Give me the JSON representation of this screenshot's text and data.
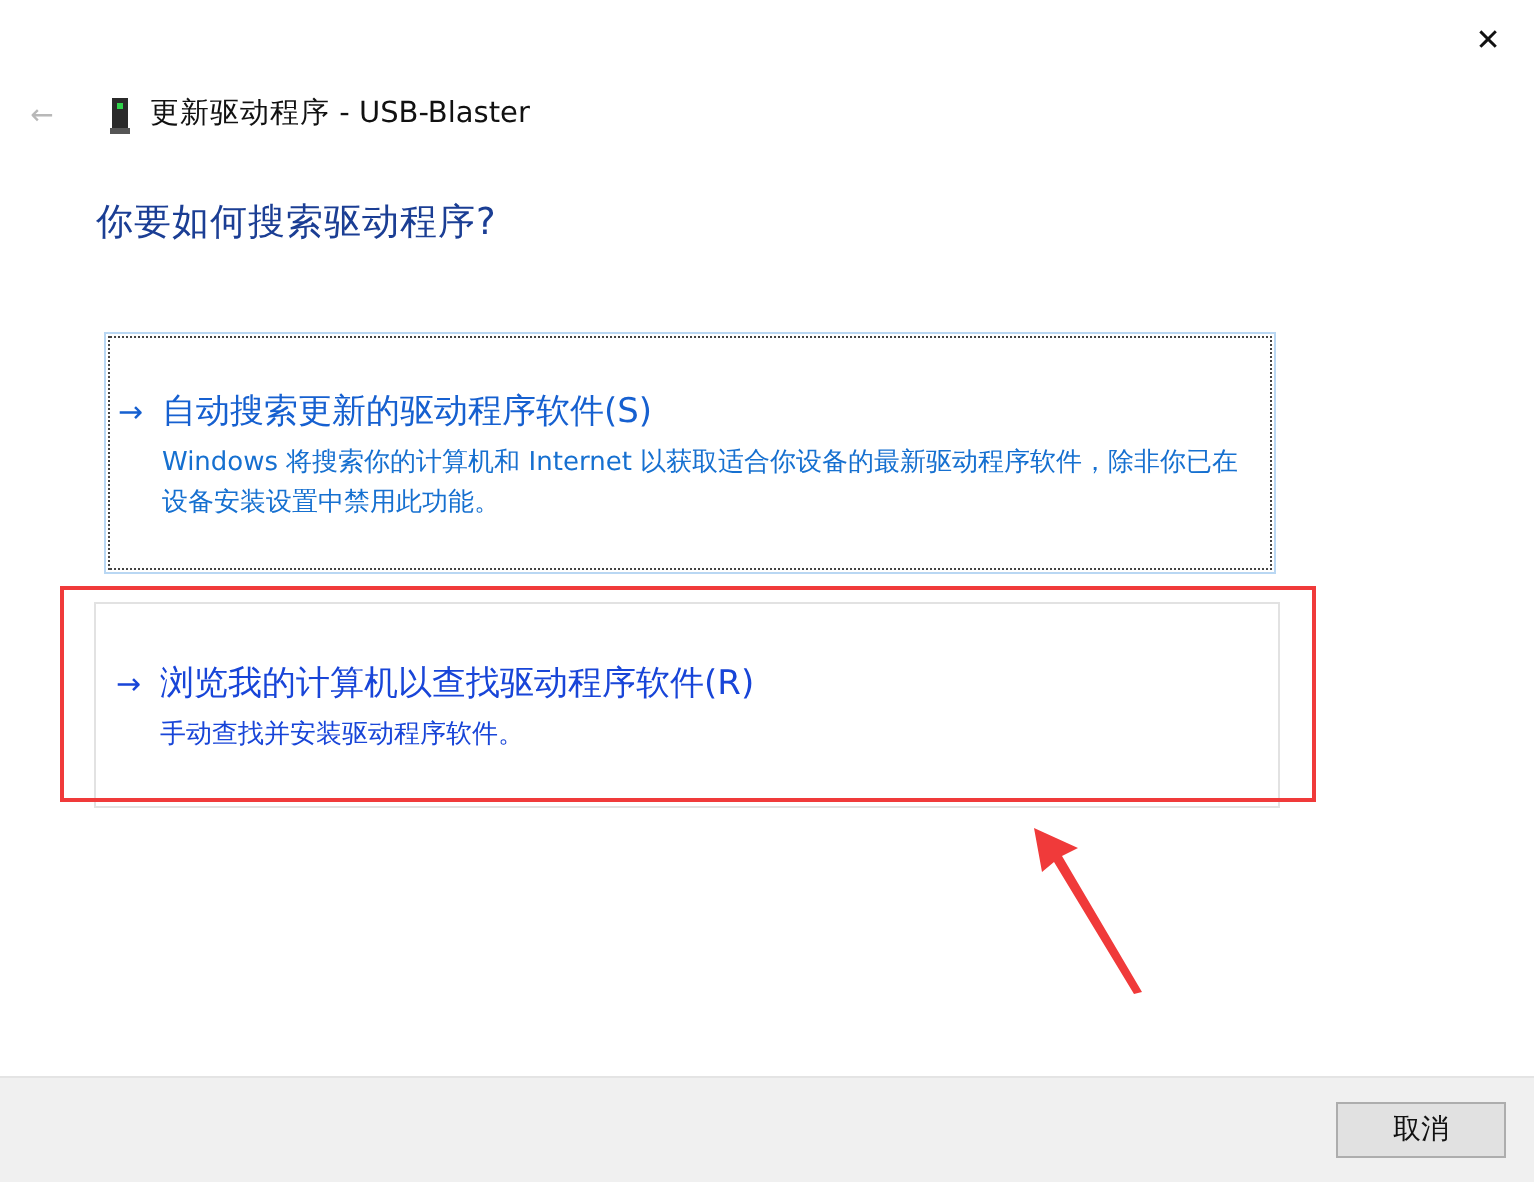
{
  "window": {
    "title": "更新驱动程序 - USB-Blaster",
    "close": "✕",
    "back": "←"
  },
  "heading": "你要如何搜索驱动程序?",
  "options": [
    {
      "arrow": "→",
      "title": "自动搜索更新的驱动程序软件(S)",
      "description": "Windows 将搜索你的计算机和 Internet 以获取适合你设备的最新驱动程序软件，除非你已在设备安装设置中禁用此功能。",
      "focused": true,
      "highlighted": false
    },
    {
      "arrow": "→",
      "title": "浏览我的计算机以查找驱动程序软件(R)",
      "description": "手动查找并安装驱动程序软件。",
      "focused": false,
      "highlighted": true
    }
  ],
  "buttons": [
    "取消"
  ]
}
